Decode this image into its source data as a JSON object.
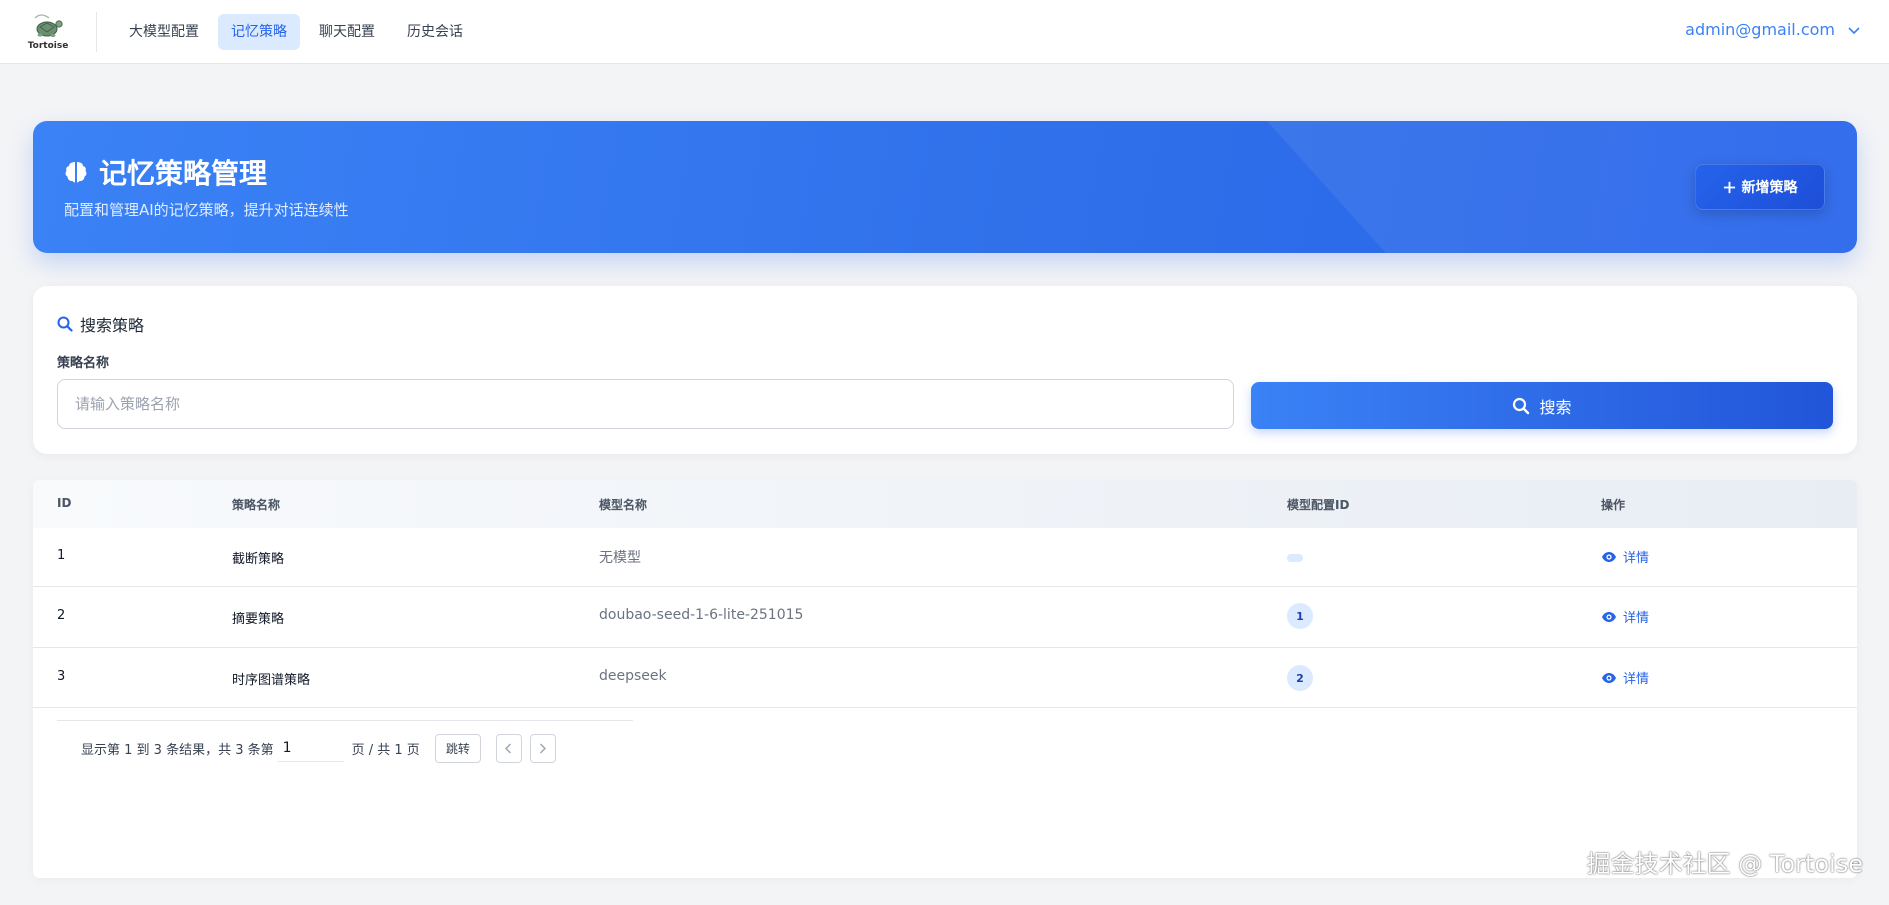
{
  "brand": {
    "logo_text": "Tortoise"
  },
  "nav": {
    "items": [
      {
        "label": "大模型配置",
        "active": false
      },
      {
        "label": "记忆策略",
        "active": true
      },
      {
        "label": "聊天配置",
        "active": false
      },
      {
        "label": "历史会话",
        "active": false
      }
    ],
    "user_email": "admin@gmail.com"
  },
  "hero": {
    "title": "记忆策略管理",
    "subtitle": "配置和管理AI的记忆策略，提升对话连续性",
    "add_button": "新增策略"
  },
  "search": {
    "heading": "搜索策略",
    "field_label": "策略名称",
    "placeholder": "请输入策略名称",
    "value": "",
    "button": "搜索"
  },
  "table": {
    "columns": [
      "ID",
      "策略名称",
      "模型名称",
      "模型配置ID",
      "操作"
    ],
    "rows": [
      {
        "id": "1",
        "name": "截断策略",
        "model": "无模型",
        "config_id": "",
        "action": "详情"
      },
      {
        "id": "2",
        "name": "摘要策略",
        "model": "doubao-seed-1-6-lite-251015",
        "config_id": "1",
        "action": "详情"
      },
      {
        "id": "3",
        "name": "时序图谱策略",
        "model": "deepseek",
        "config_id": "2",
        "action": "详情"
      }
    ]
  },
  "pagination": {
    "summary": "显示第 1 到 3 条结果，共 3 条",
    "goto_prefix": "第",
    "current_page": "1",
    "page_suffix": "页 / 共 1 页",
    "jump_button": "跳转"
  },
  "watermark": "掘金技术社区 @ Tortoise",
  "colors": {
    "accent": "#2563eb",
    "hero_start": "#3b82f6",
    "badge_bg": "#dbeafe"
  }
}
